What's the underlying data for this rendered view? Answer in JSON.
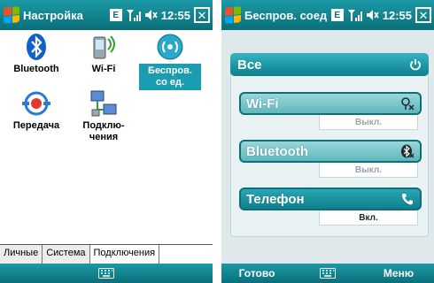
{
  "status": {
    "network_badge": "E",
    "time": "12:55"
  },
  "left": {
    "title": "Настройка",
    "icons": [
      {
        "label": "Bluetooth",
        "icon": "bluetooth-icon"
      },
      {
        "label": "Wi-Fi",
        "icon": "wifi-icon"
      },
      {
        "label": "Беспров. со ед.",
        "icon": "wireless-manager-icon",
        "selected": true
      },
      {
        "label": "Передача",
        "icon": "beam-icon"
      },
      {
        "label": "Подклю-чения",
        "icon": "connections-icon"
      }
    ],
    "tabs": [
      {
        "label": "Личные",
        "active": false
      },
      {
        "label": "Система",
        "active": false
      },
      {
        "label": "Подключения",
        "active": true
      }
    ]
  },
  "right": {
    "title": "Беспров. соед",
    "all_label": "Все",
    "radios": [
      {
        "name": "Wi-Fi",
        "status": "Выкл.",
        "on": false,
        "icon": "wifi-off-icon"
      },
      {
        "name": "Bluetooth",
        "status": "Выкл.",
        "on": false,
        "icon": "bluetooth-off-icon"
      },
      {
        "name": "Телефон",
        "status": "Вкл.",
        "on": true,
        "icon": "phone-icon"
      }
    ],
    "softkeys": {
      "left": "Готово",
      "right": "Меню"
    }
  },
  "colors": {
    "titlebar": "#0a6f7a",
    "accent": "#1b9db1",
    "radio_on": "#0f7f8c",
    "radio_off": "#5fb7bd"
  }
}
